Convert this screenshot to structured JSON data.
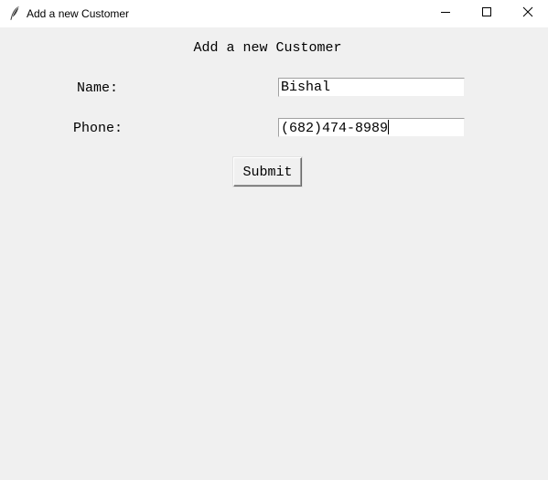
{
  "window": {
    "title": "Add a new Customer",
    "icon": "feather-icon",
    "controls": [
      "minimize-icon",
      "maximize-icon",
      "close-icon"
    ]
  },
  "form": {
    "heading": "Add a new Customer",
    "name_label": "Name:",
    "name_value": "Bishal",
    "phone_label": "Phone:",
    "phone_value": "(682)474-8989",
    "submit_label": "Submit"
  }
}
